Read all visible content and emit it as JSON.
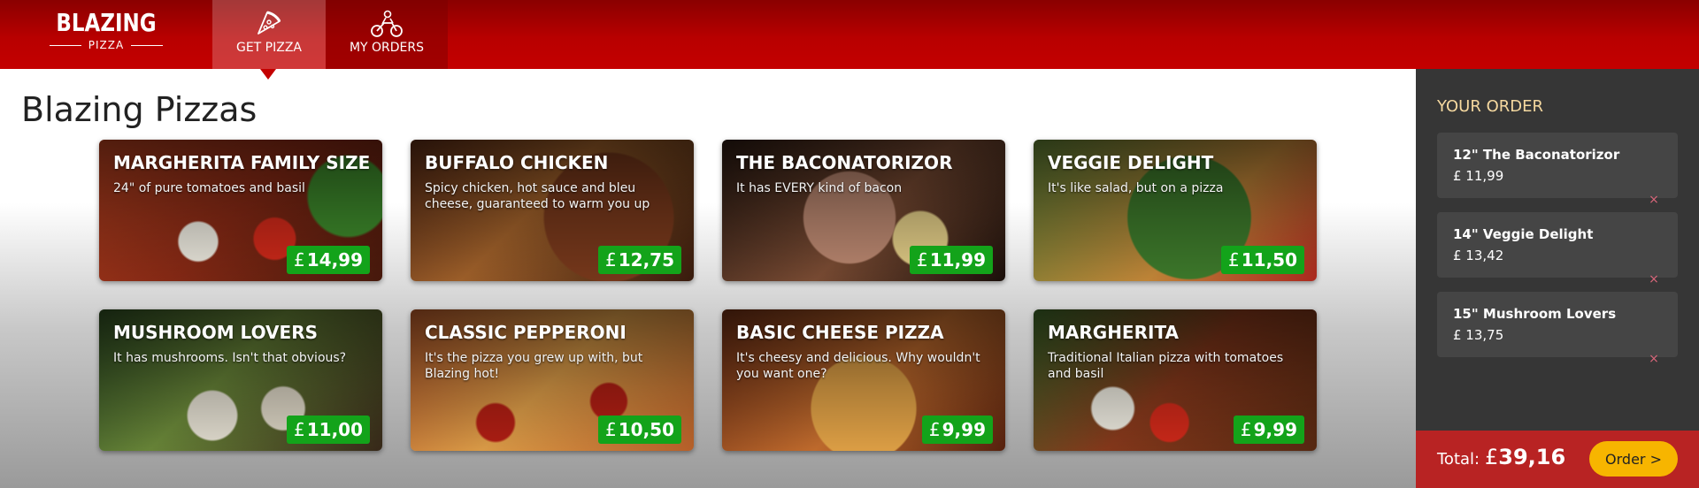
{
  "brand": {
    "name": "BLAZING",
    "sub": "PIZZA"
  },
  "nav": {
    "get_pizza": "GET PIZZA",
    "my_orders": "MY ORDERS"
  },
  "page_title": "Blazing Pizzas",
  "currency_symbol": "£",
  "specials": [
    {
      "name": "MARGHERITA FAMILY SIZE",
      "description": "24\" of pure tomatoes and basil",
      "price": "14,99"
    },
    {
      "name": "BUFFALO CHICKEN",
      "description": "Spicy chicken, hot sauce and bleu cheese, guaranteed to warm you up",
      "price": "12,75"
    },
    {
      "name": "THE BACONATORIZOR",
      "description": "It has EVERY kind of bacon",
      "price": "11,99"
    },
    {
      "name": "VEGGIE DELIGHT",
      "description": "It's like salad, but on a pizza",
      "price": "11,50"
    },
    {
      "name": "MUSHROOM LOVERS",
      "description": "It has mushrooms. Isn't that obvious?",
      "price": "11,00"
    },
    {
      "name": "CLASSIC PEPPERONI",
      "description": "It's the pizza you grew up with, but Blazing hot!",
      "price": "10,50"
    },
    {
      "name": "BASIC CHEESE PIZZA",
      "description": "It's cheesy and delicious. Why wouldn't you want one?",
      "price": "9,99"
    },
    {
      "name": "MARGHERITA",
      "description": "Traditional Italian pizza with tomatoes and basil",
      "price": "9,99"
    }
  ],
  "order": {
    "title": "YOUR ORDER",
    "items": [
      {
        "name": "12\" The Baconatorizor",
        "price": "£ 11,99",
        "remove": "×"
      },
      {
        "name": "14\" Veggie Delight",
        "price": "£ 13,42",
        "remove": "×"
      },
      {
        "name": "15\" Mushroom Lovers",
        "price": "£ 13,75",
        "remove": "×"
      }
    ],
    "total_label": "Total:",
    "total_value": "39,16",
    "order_button": "Order >"
  },
  "colors": {
    "header_red": "#c40000",
    "price_green": "#13a31a",
    "sidebar_bg": "#363636",
    "total_bar": "#b82323",
    "order_button": "#f7b500",
    "sidebar_title": "#f6d9a0"
  },
  "icons": {
    "get_pizza": "pizza-slice-icon",
    "my_orders": "motorbike-icon",
    "remove": "remove-x-icon"
  }
}
